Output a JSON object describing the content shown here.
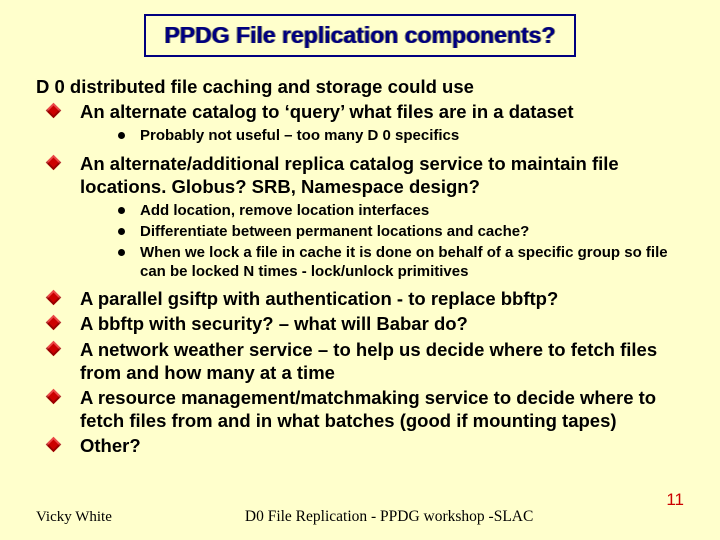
{
  "title": "PPDG File replication components?",
  "intro": "D 0 distributed file caching and storage could use",
  "bullets": [
    {
      "text": "An alternate catalog to ‘query’ what files are in a dataset",
      "sub": [
        "Probably not useful – too many D 0 specifics"
      ]
    },
    {
      "text": "An alternate/additional replica catalog service to maintain file locations.  Globus?  SRB, Namespace design?",
      "sub": [
        "Add location, remove location interfaces",
        "Differentiate between permanent locations and cache?",
        "When we lock a file in cache it is done on behalf of a specific group so file can be locked N times  - lock/unlock primitives"
      ]
    },
    {
      "text": "A parallel gsiftp with authentication  - to replace bbftp?"
    },
    {
      "text": "A bbftp with security? – what will Babar do?"
    },
    {
      "text": "A network weather service – to help us decide where to fetch files from and how many at a time"
    },
    {
      "text": "A resource management/matchmaking service to decide where to fetch files from and in what batches (good if mounting tapes)"
    },
    {
      "text": "Other?"
    }
  ],
  "footer": {
    "author": "Vicky White",
    "center": "D0 File Replication - PPDG workshop -SLAC",
    "page": "11"
  }
}
